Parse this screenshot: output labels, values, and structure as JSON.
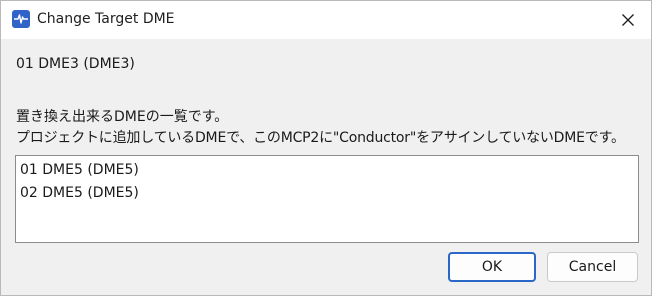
{
  "window": {
    "title": "Change Target DME"
  },
  "current_target": "01 DME3 (DME3)",
  "description": {
    "line1": "置き換え出来るDMEの一覧です。",
    "line2": "プロジェクトに追加しているDMEで、このMCP2に\"Conductor\"をアサインしていないDMEです。"
  },
  "list": {
    "items": [
      {
        "label": "01 DME5 (DME5)"
      },
      {
        "label": "02 DME5 (DME5)"
      }
    ]
  },
  "buttons": {
    "ok": "OK",
    "cancel": "Cancel"
  },
  "colors": {
    "accent": "#2b67c6",
    "app_icon": "#2f63c8",
    "dialog_bg": "#f0f0f0"
  },
  "icons": {
    "app": "waveform-icon",
    "close": "close-icon"
  }
}
